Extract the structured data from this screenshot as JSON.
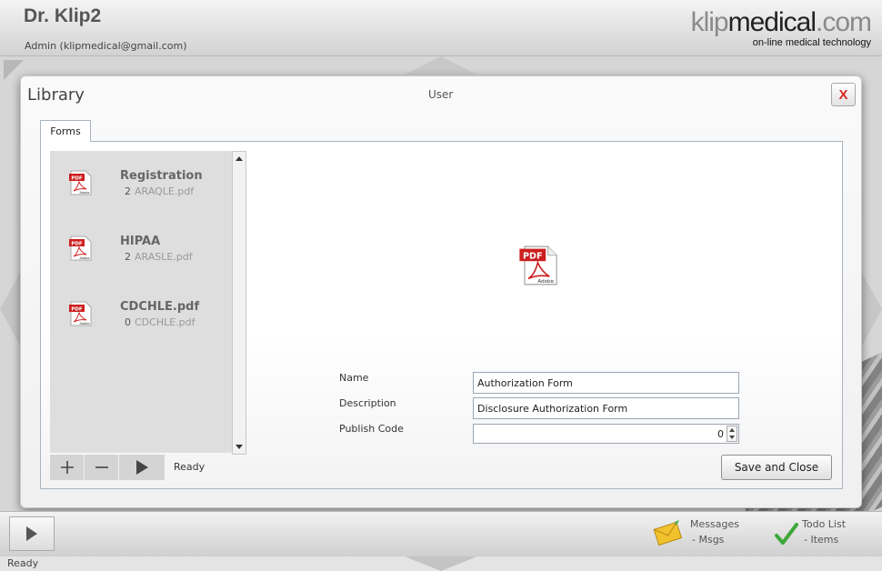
{
  "header": {
    "app_title": "Dr. Klip2",
    "user": "Admin (klipmedical@gmail.com)",
    "logo": {
      "part1": "klip",
      "part2": "medical",
      "part3": ".com",
      "tagline": "on-line medical technology"
    }
  },
  "dialog": {
    "title": "Library",
    "context": "User",
    "close_label": "X",
    "tabs": [
      {
        "label": "Forms"
      }
    ],
    "list": {
      "items": [
        {
          "name": "Registration",
          "count": "2",
          "file": "ARAQLE.pdf"
        },
        {
          "name": "HIPAA",
          "count": "2",
          "file": "ARASLE.pdf"
        },
        {
          "name": "CDCHLE.pdf",
          "count": "0",
          "file": "CDCHLE.pdf"
        }
      ],
      "status": "Ready"
    },
    "form": {
      "name_label": "Name",
      "name_value": "Authorization Form",
      "description_label": "Description",
      "description_value": "Disclosure Authorization Form",
      "publish_code_label": "Publish Code",
      "publish_code_value": "0"
    },
    "save_label": "Save and Close"
  },
  "bottom_bar": {
    "messages": {
      "label": "Messages",
      "sub": "- Msgs"
    },
    "todo": {
      "label": "Todo List",
      "sub": "- Items"
    }
  },
  "status_bar": {
    "text": "Ready"
  },
  "colors": {
    "close_x": "#d62b1f",
    "pdf_red": "#cc1f1f",
    "check_green": "#3ea83a",
    "envelope": "#f2c12e"
  }
}
